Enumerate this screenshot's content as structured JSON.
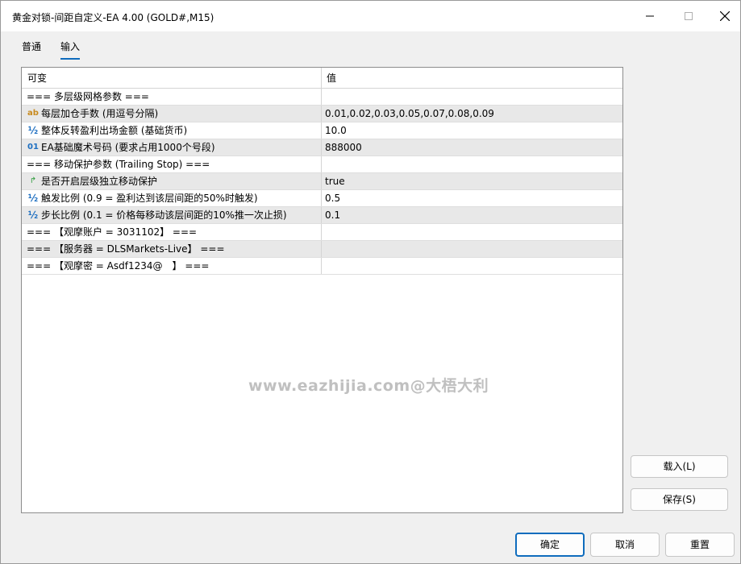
{
  "window": {
    "title": "黄金对锁-间距自定义-EA 4.00 (GOLD#,M15)"
  },
  "tabs": [
    {
      "label": "普通"
    },
    {
      "label": "输入"
    }
  ],
  "grid": {
    "col_variable": "可变",
    "col_value": "值",
    "rows": [
      {
        "icon": "",
        "name": "=== 多层级网格参数 ===",
        "value": ""
      },
      {
        "icon": "ab",
        "name": "每层加仓手数 (用逗号分隔)",
        "value": "0.01,0.02,0.03,0.05,0.07,0.08,0.09"
      },
      {
        "icon": "½",
        "name": "整体反转盈利出场金额 (基础货币)",
        "value": "10.0"
      },
      {
        "icon": "01",
        "name": "EA基础魔术号码 (要求占用1000个号段)",
        "value": "888000"
      },
      {
        "icon": "",
        "name": "=== 移动保护参数 (Trailing Stop) ===",
        "value": ""
      },
      {
        "icon": "↱",
        "name": "是否开启层级独立移动保护",
        "value": "true"
      },
      {
        "icon": "½",
        "name": "触发比例 (0.9 = 盈利达到该层间距的50%时触发)",
        "value": "0.5"
      },
      {
        "icon": "½",
        "name": "步长比例 (0.1 = 价格每移动该层间距的10%推一次止损)",
        "value": "0.1"
      },
      {
        "icon": "",
        "name": "=== 【观摩账户 = 3031102】 ===",
        "value": ""
      },
      {
        "icon": "",
        "name": "=== 【服务器 = DLSMarkets-Live】 ===",
        "value": ""
      },
      {
        "icon": "",
        "name": "=== 【观摩密 = Asdf1234@　】 ===",
        "value": ""
      }
    ]
  },
  "watermark": "www.eazhijia.com@大梧大利",
  "side_buttons": {
    "load": "载入(L)",
    "save": "保存(S)"
  },
  "footer_buttons": {
    "ok": "确定",
    "cancel": "取消",
    "reset": "重置"
  },
  "colors": {
    "accent": "#0f6cbd",
    "row_alt": "#e8e8e8"
  }
}
